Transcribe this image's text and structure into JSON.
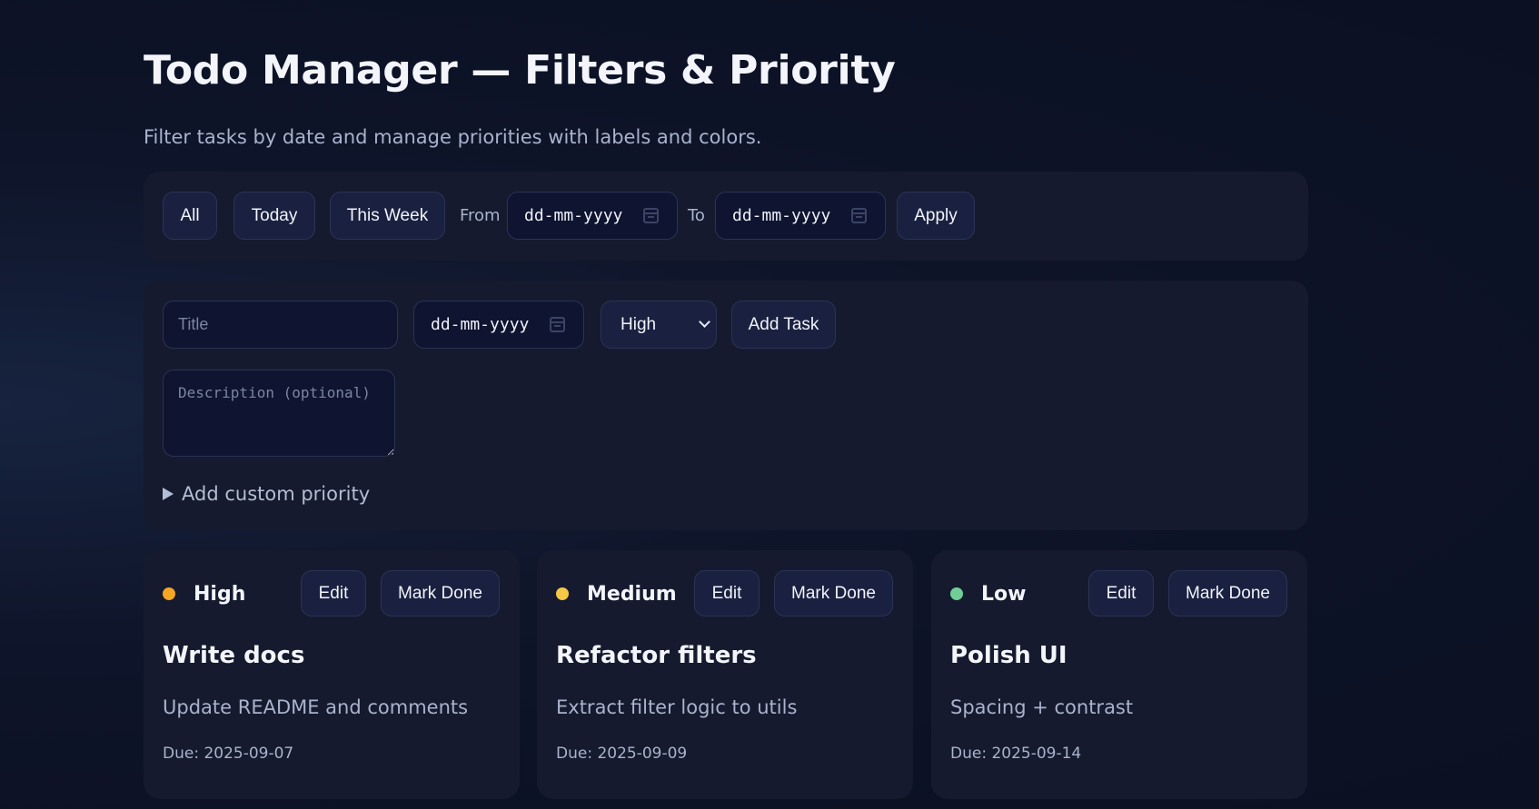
{
  "header": {
    "title": "Todo Manager — Filters & Priority",
    "subtitle": "Filter tasks by date and manage priorities with labels and colors."
  },
  "filters": {
    "all_label": "All",
    "today_label": "Today",
    "week_label": "This Week",
    "from_label": "From",
    "from_value": "dd-mm-yyyy",
    "to_label": "To",
    "to_value": "dd-mm-yyyy",
    "apply_label": "Apply"
  },
  "composer": {
    "title_placeholder": "Title",
    "date_value": "dd-mm-yyyy",
    "priority_selected": "High",
    "add_label": "Add Task",
    "description_placeholder": "Description (optional)",
    "custom_priority_label": "Add custom priority"
  },
  "tasks": [
    {
      "priority": "High",
      "priority_color": "#f5a623",
      "edit_label": "Edit",
      "done_label": "Mark Done",
      "title": "Write docs",
      "description": "Update README and comments",
      "due": "Due: 2025-09-07"
    },
    {
      "priority": "Medium",
      "priority_color": "#f6c744",
      "edit_label": "Edit",
      "done_label": "Mark Done",
      "title": "Refactor filters",
      "description": "Extract filter logic to utils",
      "due": "Due: 2025-09-09"
    },
    {
      "priority": "Low",
      "priority_color": "#6fcf97",
      "edit_label": "Edit",
      "done_label": "Mark Done",
      "title": "Polish UI",
      "description": "Spacing + contrast",
      "due": "Due: 2025-09-14"
    }
  ]
}
